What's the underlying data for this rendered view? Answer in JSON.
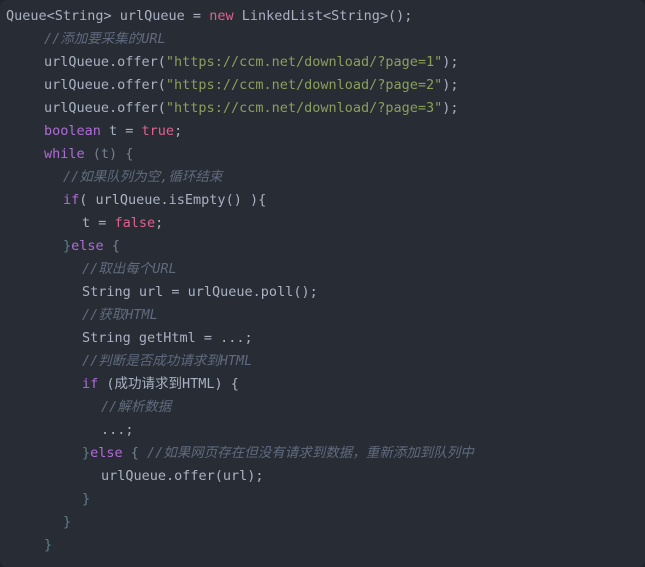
{
  "editor": {
    "name": "java-code-snippet",
    "language": "Java",
    "background_color": "#282c35",
    "default_text_color": "#a9b2c3",
    "colors": {
      "keyword": "#b06cd8",
      "literal": "#e0628f",
      "string": "#8aa05a",
      "comment": "#5f6b7d",
      "punctuation": "#72808f",
      "brace": "#5d7f8a"
    }
  },
  "lines": [
    {
      "indent": 0,
      "tokens": [
        {
          "t": "Queue<String> urlQueue = ",
          "c": "plain"
        },
        {
          "t": "new",
          "c": "lit"
        },
        {
          "t": " LinkedList<String>();",
          "c": "plain"
        }
      ]
    },
    {
      "indent": 2,
      "tokens": [
        {
          "t": "//添加要采集的URL",
          "c": "com"
        }
      ]
    },
    {
      "indent": 2,
      "tokens": [
        {
          "t": "urlQueue.offer(",
          "c": "plain"
        },
        {
          "t": "\"https://ccm.net/download/?page=1\"",
          "c": "str"
        },
        {
          "t": ");",
          "c": "plain"
        }
      ]
    },
    {
      "indent": 2,
      "tokens": [
        {
          "t": "urlQueue.offer(",
          "c": "plain"
        },
        {
          "t": "\"https://ccm.net/download/?page=2\"",
          "c": "str"
        },
        {
          "t": ");",
          "c": "plain"
        }
      ]
    },
    {
      "indent": 2,
      "tokens": [
        {
          "t": "urlQueue.offer(",
          "c": "plain"
        },
        {
          "t": "\"https://ccm.net/download/?page=3\"",
          "c": "str"
        },
        {
          "t": ");",
          "c": "plain"
        }
      ]
    },
    {
      "indent": 2,
      "tokens": [
        {
          "t": "boolean",
          "c": "kw"
        },
        {
          "t": " t = ",
          "c": "plain"
        },
        {
          "t": "true",
          "c": "lit"
        },
        {
          "t": ";",
          "c": "plain"
        }
      ]
    },
    {
      "indent": 2,
      "tokens": [
        {
          "t": "while",
          "c": "kw"
        },
        {
          "t": " (t) {",
          "c": "punc"
        }
      ]
    },
    {
      "indent": 3,
      "tokens": [
        {
          "t": "//如果队列为空,循环结束",
          "c": "com"
        }
      ]
    },
    {
      "indent": 3,
      "tokens": [
        {
          "t": "if",
          "c": "kw"
        },
        {
          "t": "( urlQueue.isEmpty() ){",
          "c": "plain"
        }
      ]
    },
    {
      "indent": 4,
      "tokens": [
        {
          "t": "t = ",
          "c": "plain"
        },
        {
          "t": "false",
          "c": "lit"
        },
        {
          "t": ";",
          "c": "plain"
        }
      ]
    },
    {
      "indent": 3,
      "tokens": [
        {
          "t": "}",
          "c": "brace"
        },
        {
          "t": "else",
          "c": "kw"
        },
        {
          "t": " {",
          "c": "punc"
        }
      ]
    },
    {
      "indent": 4,
      "tokens": [
        {
          "t": "//取出每个URL",
          "c": "com"
        }
      ]
    },
    {
      "indent": 4,
      "tokens": [
        {
          "t": "String url = urlQueue.poll();",
          "c": "plain"
        }
      ]
    },
    {
      "indent": 4,
      "tokens": [
        {
          "t": "//获取HTML",
          "c": "com"
        }
      ]
    },
    {
      "indent": 4,
      "tokens": [
        {
          "t": "String getHtml = ...;",
          "c": "plain"
        }
      ]
    },
    {
      "indent": 4,
      "tokens": [
        {
          "t": "//判断是否成功请求到HTML",
          "c": "com"
        }
      ]
    },
    {
      "indent": 4,
      "tokens": [
        {
          "t": "if",
          "c": "kw"
        },
        {
          "t": " (成功请求到HTML) {",
          "c": "plain"
        }
      ]
    },
    {
      "indent": 5,
      "tokens": [
        {
          "t": "//解析数据",
          "c": "com"
        }
      ]
    },
    {
      "indent": 5,
      "tokens": [
        {
          "t": "...;",
          "c": "plain"
        }
      ]
    },
    {
      "indent": 4,
      "tokens": [
        {
          "t": "}",
          "c": "brace"
        },
        {
          "t": "else",
          "c": "kw"
        },
        {
          "t": " { ",
          "c": "punc"
        },
        {
          "t": "//如果网页存在但没有请求到数据，重新添加到队列中",
          "c": "com"
        }
      ]
    },
    {
      "indent": 5,
      "tokens": [
        {
          "t": "urlQueue.offer(url);",
          "c": "plain"
        }
      ]
    },
    {
      "indent": 4,
      "tokens": [
        {
          "t": "}",
          "c": "brace"
        }
      ]
    },
    {
      "indent": 3,
      "tokens": [
        {
          "t": "}",
          "c": "brace"
        }
      ]
    },
    {
      "indent": 2,
      "tokens": [
        {
          "t": "}",
          "c": "brace"
        }
      ]
    }
  ]
}
